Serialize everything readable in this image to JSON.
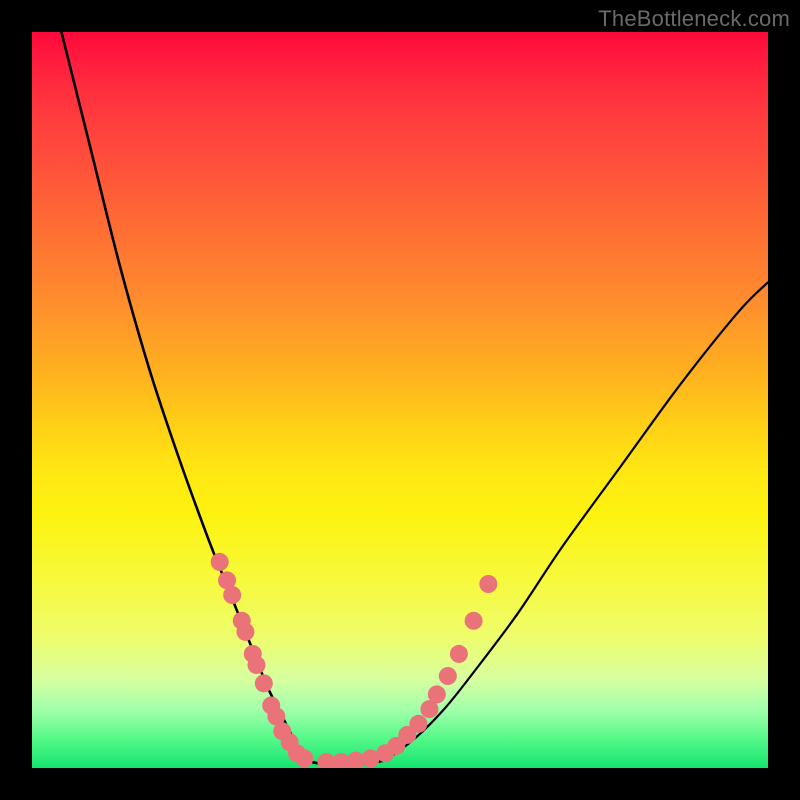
{
  "watermark": "TheBottleneck.com",
  "chart_data": {
    "type": "line",
    "title": "",
    "xlabel": "",
    "ylabel": "",
    "xlim": [
      0,
      100
    ],
    "ylim": [
      0,
      100
    ],
    "series": [
      {
        "name": "curve-left",
        "x": [
          4,
          8,
          12,
          16,
          20,
          24,
          26,
          28,
          30,
          32,
          34,
          36,
          37
        ],
        "y": [
          100,
          84,
          68,
          54,
          42,
          31,
          26,
          21,
          16,
          11,
          7,
          3,
          1
        ]
      },
      {
        "name": "curve-floor",
        "x": [
          37,
          40,
          44,
          48
        ],
        "y": [
          1,
          0.5,
          0.5,
          1
        ]
      },
      {
        "name": "curve-right",
        "x": [
          48,
          52,
          56,
          60,
          66,
          72,
          80,
          88,
          96,
          100
        ],
        "y": [
          1,
          4,
          8,
          13,
          21,
          30,
          41,
          52,
          62,
          66
        ]
      }
    ],
    "left_markers": {
      "name": "beads-left",
      "x": [
        25.5,
        26.5,
        27.2,
        28.5,
        29.0,
        30.0,
        30.5,
        31.5,
        32.5,
        33.2,
        34.0,
        35.0,
        36.0,
        37.0
      ],
      "y": [
        28.0,
        25.5,
        23.5,
        20.0,
        18.5,
        15.5,
        14.0,
        11.5,
        8.5,
        7.0,
        5.0,
        3.5,
        2.0,
        1.3
      ]
    },
    "right_markers": {
      "name": "beads-right",
      "x": [
        40.0,
        42.0,
        44.0,
        46.0,
        48.0,
        49.5,
        51.0,
        52.5,
        54.0,
        55.0,
        56.5,
        58.0,
        60.0,
        62.0
      ],
      "y": [
        0.8,
        0.8,
        1.0,
        1.3,
        2.0,
        3.0,
        4.5,
        6.0,
        8.0,
        10.0,
        12.5,
        15.5,
        20.0,
        25.0
      ]
    },
    "colors": {
      "curve": "#000000",
      "marker_fill": "#e97378",
      "marker_stroke": "#c95a60"
    }
  }
}
